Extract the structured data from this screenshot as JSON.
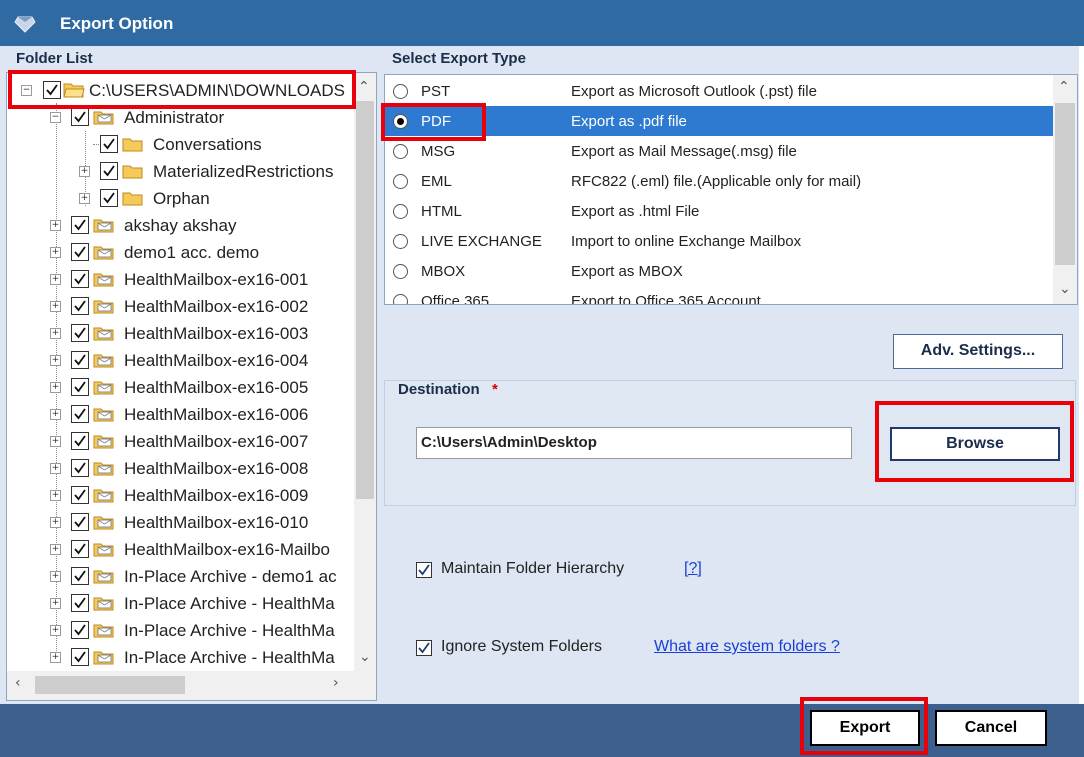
{
  "window": {
    "title": "Export Option"
  },
  "folder_list": {
    "header": "Folder List",
    "root": "C:\\USERS\\ADMIN\\DOWNLOADS",
    "admin_folder": "Administrator",
    "admin_children": [
      "Conversations",
      "MaterializedRestrictions",
      "Orphan"
    ],
    "mailboxes": [
      "akshay akshay",
      "demo1 acc. demo",
      "HealthMailbox-ex16-001",
      "HealthMailbox-ex16-002",
      "HealthMailbox-ex16-003",
      "HealthMailbox-ex16-004",
      "HealthMailbox-ex16-005",
      "HealthMailbox-ex16-006",
      "HealthMailbox-ex16-007",
      "HealthMailbox-ex16-008",
      "HealthMailbox-ex16-009",
      "HealthMailbox-ex16-010",
      "HealthMailbox-ex16-Mailbo",
      "In-Place Archive - demo1 ac",
      "In-Place Archive - HealthMa",
      "In-Place Archive - HealthMa",
      "In-Place Archive - HealthMa"
    ]
  },
  "export_type": {
    "header": "Select Export Type",
    "selected": "PDF",
    "options": [
      {
        "name": "PST",
        "desc": "Export as Microsoft Outlook (.pst) file"
      },
      {
        "name": "PDF",
        "desc": "Export as .pdf file"
      },
      {
        "name": "MSG",
        "desc": "Export as Mail Message(.msg) file"
      },
      {
        "name": "EML",
        "desc": "RFC822 (.eml) file.(Applicable only for mail)"
      },
      {
        "name": "HTML",
        "desc": "Export as .html File"
      },
      {
        "name": "LIVE EXCHANGE",
        "desc": "Import to online Exchange Mailbox"
      },
      {
        "name": "MBOX",
        "desc": "Export as MBOX"
      },
      {
        "name": "Office 365",
        "desc": "Export to Office 365 Account"
      }
    ]
  },
  "adv_settings_label": "Adv. Settings...",
  "destination": {
    "label": "Destination",
    "required_mark": "*",
    "path": "C:\\Users\\Admin\\Desktop",
    "browse_label": "Browse"
  },
  "options": {
    "maintain_hierarchy": {
      "label": "Maintain Folder Hierarchy",
      "checked": true,
      "help": "[?]"
    },
    "ignore_system": {
      "label": "Ignore System Folders",
      "checked": true,
      "link": "What are system folders ?"
    }
  },
  "footer": {
    "export_label": "Export",
    "cancel_label": "Cancel"
  },
  "colors": {
    "titlebar": "#2f6aa3",
    "selection": "#2f7ad1",
    "highlight": "#e8000b",
    "footer": "#3d5f8d"
  }
}
